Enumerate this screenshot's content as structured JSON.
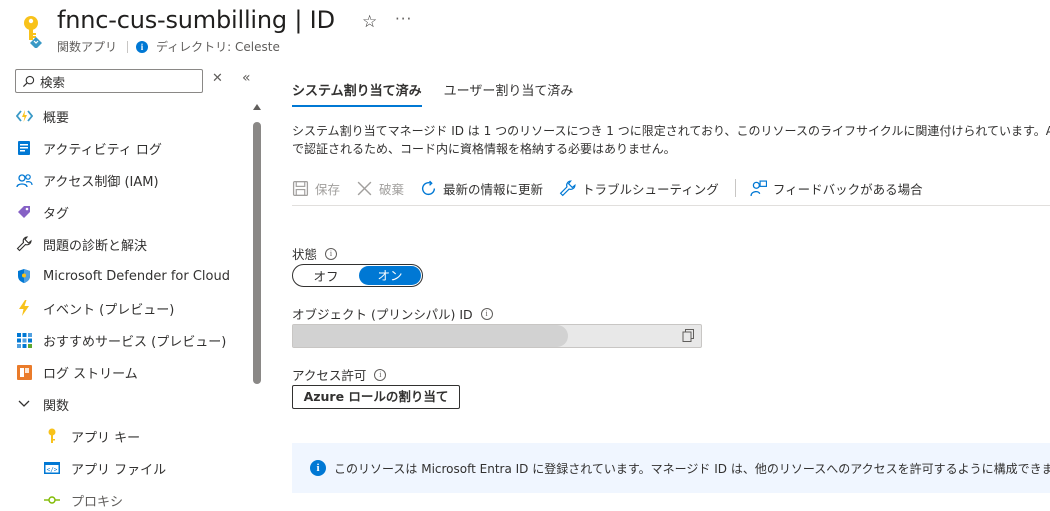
{
  "header": {
    "title": "fnnc-cus-sumbilling | ID",
    "resource_type": "関数アプリ",
    "directory": "ディレクトリ: Celeste"
  },
  "sidebar": {
    "search_placeholder": "検索",
    "items": [
      {
        "label": "概要",
        "icon": "function-icon"
      },
      {
        "label": "アクティビティ ログ",
        "icon": "activity-log-icon"
      },
      {
        "label": "アクセス制御 (IAM)",
        "icon": "iam-icon"
      },
      {
        "label": "タグ",
        "icon": "tag-icon"
      },
      {
        "label": "問題の診断と解決",
        "icon": "wrench-icon"
      },
      {
        "label": "Microsoft Defender for Cloud",
        "icon": "shield-icon"
      },
      {
        "label": "イベント (プレビュー)",
        "icon": "lightning-icon"
      },
      {
        "label": "おすすめサービス (プレビュー)",
        "icon": "grid-icon"
      },
      {
        "label": "ログ ストリーム",
        "icon": "log-stream-icon"
      },
      {
        "label": "関数",
        "icon": "chevron-down-icon"
      },
      {
        "label": "アプリ キー",
        "icon": "key-icon"
      },
      {
        "label": "アプリ ファイル",
        "icon": "file-icon"
      },
      {
        "label": "プロキシ",
        "icon": "proxy-icon"
      }
    ]
  },
  "tabs": [
    {
      "label": "システム割り当て済み",
      "active": true
    },
    {
      "label": "ユーザー割り当て済み",
      "active": false
    }
  ],
  "description": {
    "line1": "システム割り当てマネージド ID は 1 つのリソースにつき 1 つに限定されており、このリソースのライフサイクルに関連付けられています。Azure のロールベ",
    "line2": "で認証されるため、コード内に資格情報を格納する必要はありません。"
  },
  "toolbar": {
    "save": "保存",
    "discard": "破棄",
    "refresh": "最新の情報に更新",
    "troubleshoot": "トラブルシューティング",
    "feedback": "フィードバックがある場合"
  },
  "status": {
    "label": "状態",
    "off": "オフ",
    "on": "オン",
    "value": "on"
  },
  "object_id": {
    "label": "オブジェクト (プリンシパル) ID"
  },
  "access": {
    "label": "アクセス許可",
    "button": "Azure ロールの割り当て"
  },
  "info_banner": {
    "text": "このリソースは Microsoft Entra ID に登録されています。マネージド ID は、他のリソースへのアクセスを許可するように構成できます。マネージド ID のアク"
  },
  "colors": {
    "accent": "#0078d4",
    "info_bg": "#f0f6ff"
  }
}
